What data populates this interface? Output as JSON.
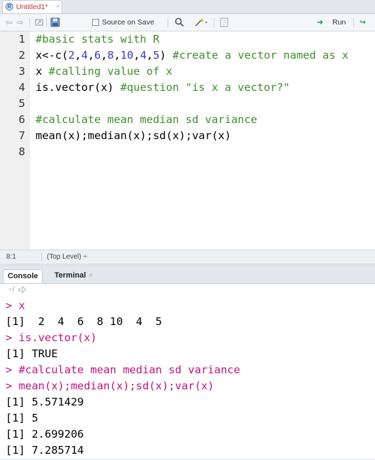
{
  "tab": {
    "title": "Untitled1*",
    "close": "×",
    "file_icon": "r-file-icon"
  },
  "toolbar": {
    "back_icon": "⇦",
    "forward_icon": "⇨",
    "source_on_save_label": "Source on Save",
    "run_label": "Run",
    "run_icon": "➜",
    "source_icon": "↪"
  },
  "editor": {
    "lines": [
      {
        "n": "1",
        "text": "#basic stats with R"
      },
      {
        "n": "2",
        "text": "x<-c(2,4,6,8,10,4,5) #create a vector named as x"
      },
      {
        "n": "3",
        "text": "x #calling value of x"
      },
      {
        "n": "4",
        "text": "is.vector(x) #question \"is x a vector?\""
      },
      {
        "n": "5",
        "text": ""
      },
      {
        "n": "6",
        "text": "#calculate mean median sd variance"
      },
      {
        "n": "7",
        "text": "mean(x);median(x);sd(x);var(x)"
      },
      {
        "n": "8",
        "text": ""
      }
    ]
  },
  "status": {
    "position": "8:1",
    "scope": "(Top Level)",
    "scope_arrow": "÷"
  },
  "console_tabs": {
    "console": "Console",
    "terminal": "Terminal",
    "terminal_close": "×"
  },
  "working_dir": "~/",
  "console": {
    "lines": [
      {
        "kind": "prompt",
        "text": "> x"
      },
      {
        "kind": "output",
        "text": "[1]  2  4  6  8 10  4  5"
      },
      {
        "kind": "prompt",
        "text": "> is.vector(x)"
      },
      {
        "kind": "output",
        "text": "[1] TRUE"
      },
      {
        "kind": "prompt",
        "text": "> #calculate mean median sd variance"
      },
      {
        "kind": "prompt",
        "text": "> mean(x);median(x);sd(x);var(x)"
      },
      {
        "kind": "output",
        "text": "[1] 5.571429"
      },
      {
        "kind": "output",
        "text": "[1] 5"
      },
      {
        "kind": "output",
        "text": "[1] 2.699206"
      },
      {
        "kind": "output",
        "text": "[1] 7.285714"
      }
    ]
  },
  "colors": {
    "comment": "#3e8e2e",
    "number": "#3a37c8",
    "prompt": "#c0147f",
    "tab_title": "#c0392b"
  }
}
